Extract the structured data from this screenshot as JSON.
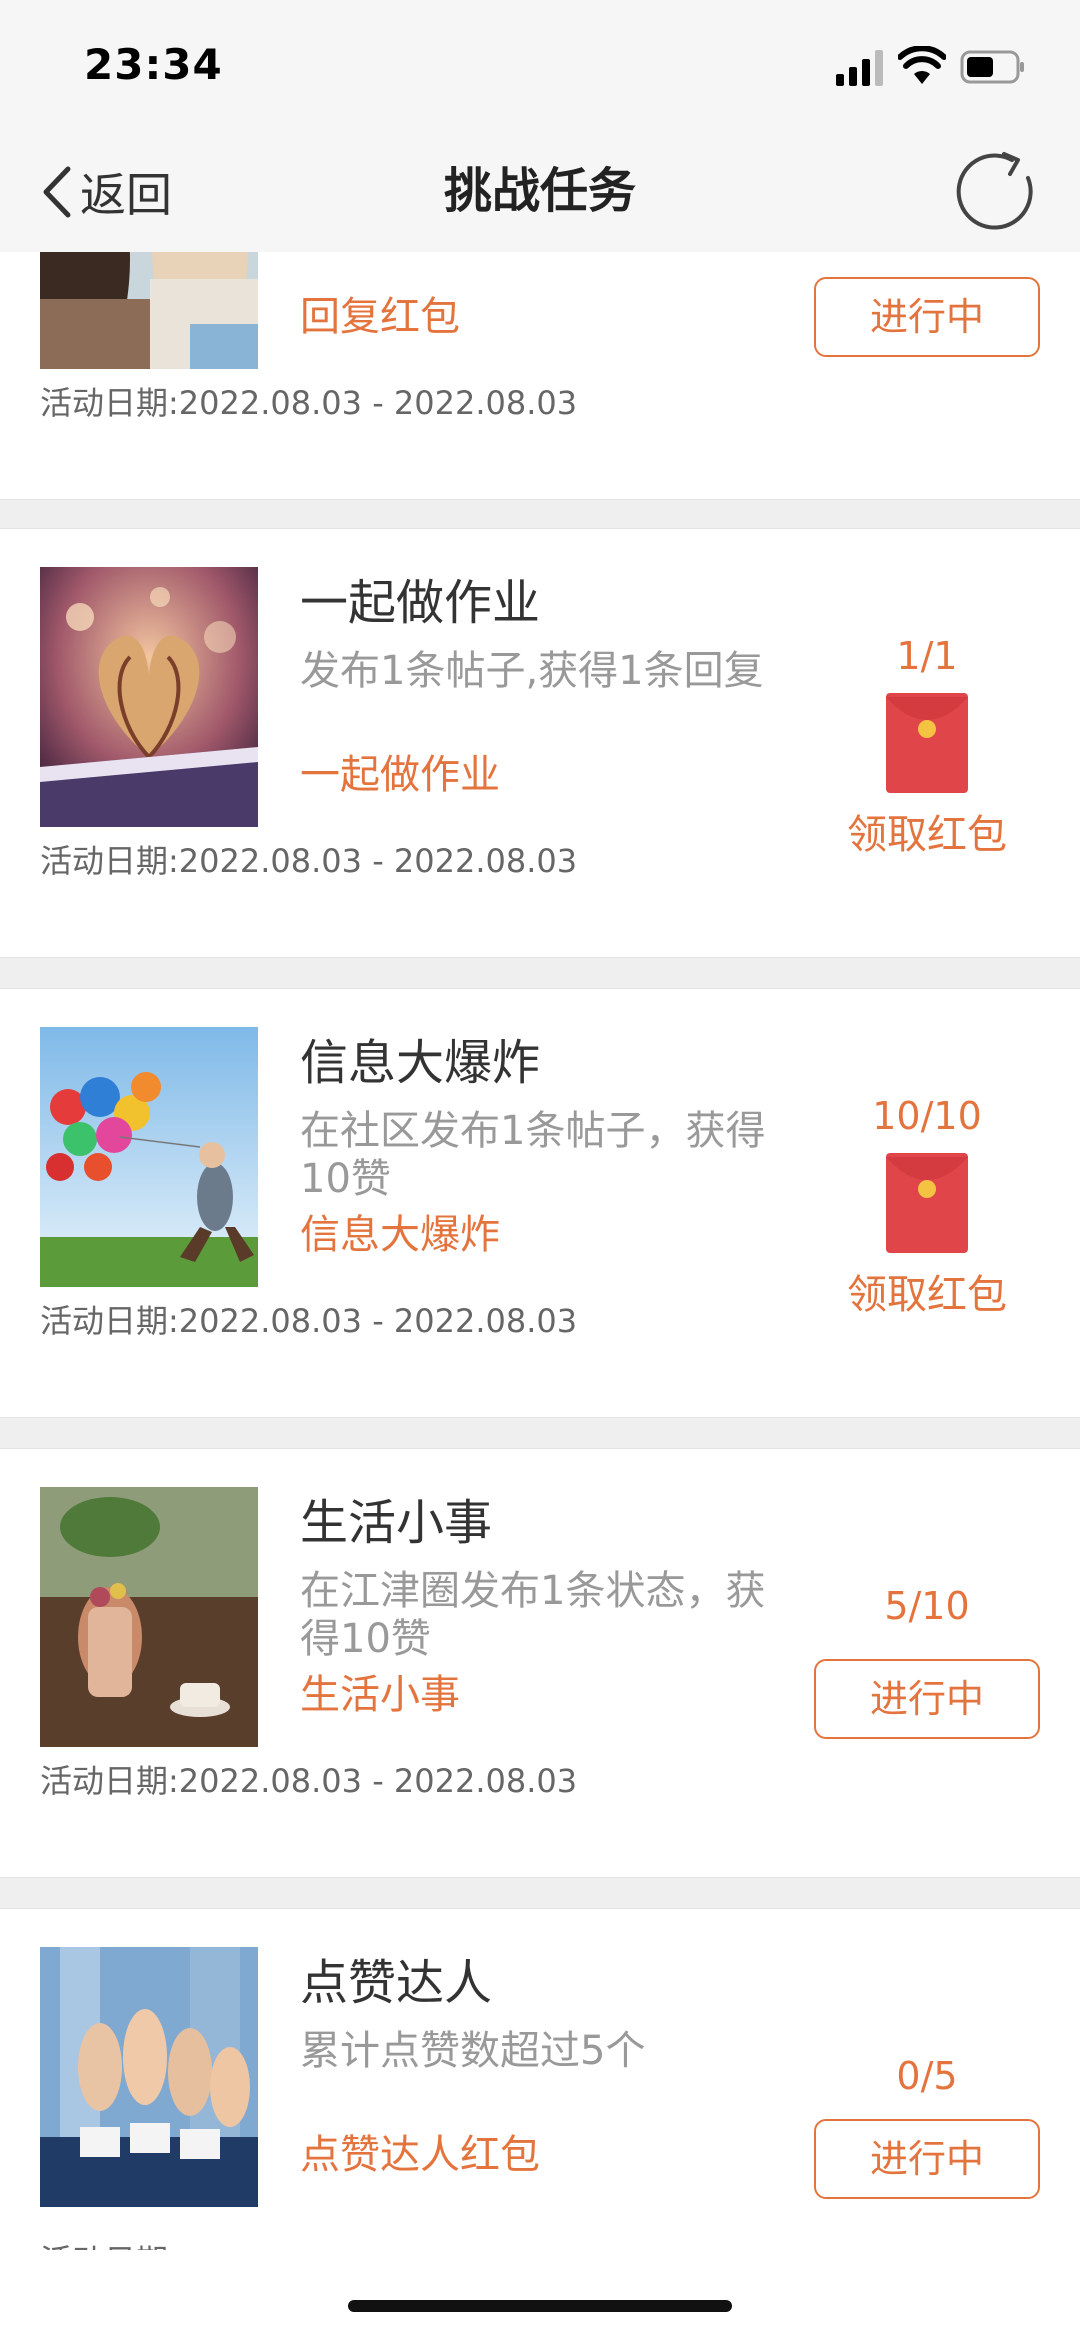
{
  "status_bar": {
    "time": "23:34"
  },
  "nav": {
    "back_label": "返回",
    "title": "挑战任务"
  },
  "tasks": [
    {
      "title": "",
      "desc": "",
      "reward": "回复红包",
      "date_label": "活动日期:",
      "date_range": "2022.08.03 - 2022.08.03",
      "progress": "",
      "status": "进行中",
      "image": "girls-photo"
    },
    {
      "title": "一起做作业",
      "desc": "发布1条帖子,获得1条回复",
      "reward": "一起做作业",
      "date_label": "活动日期:",
      "date_range": "2022.08.03 - 2022.08.03",
      "progress": "1/1",
      "claim": "领取红包",
      "image": "heart-book-photo"
    },
    {
      "title": "信息大爆炸",
      "desc": "在社区发布1条帖子，获得10赞",
      "reward": "信息大爆炸",
      "date_label": "活动日期:",
      "date_range": "2022.08.03 - 2022.08.03",
      "progress": "10/10",
      "claim": "领取红包",
      "image": "balloons-photo"
    },
    {
      "title": "生活小事",
      "desc": "在江津圈发布1条状态，获得10赞",
      "reward": "生活小事",
      "date_label": "活动日期:",
      "date_range": "2022.08.03 - 2022.08.03",
      "progress": "5/10",
      "status": "进行中",
      "image": "teapot-photo"
    },
    {
      "title": "点赞达人",
      "desc": "累计点赞数超过5个",
      "reward": "点赞达人红包",
      "date_label": "活动日期:",
      "progress": "0/5",
      "status": "进行中",
      "image": "thumbs-up-photo"
    }
  ],
  "colors": {
    "accent": "#e4743e",
    "envelope": "#e0454a",
    "background": "#efefef"
  }
}
